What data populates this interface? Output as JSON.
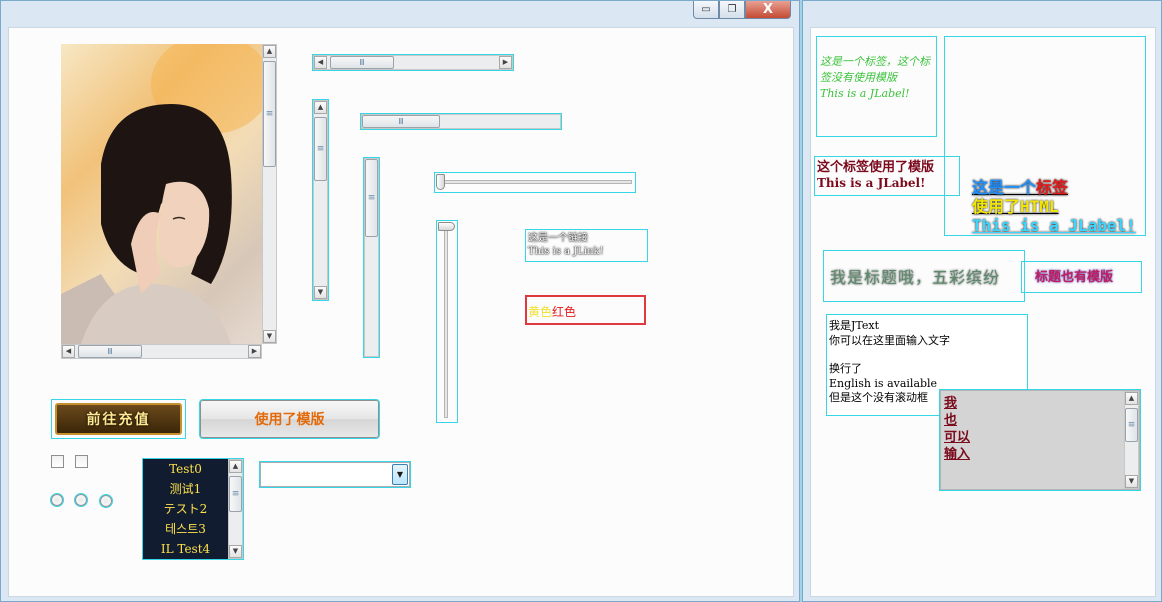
{
  "window_controls": {
    "minimize": "▭",
    "restore": "❐",
    "close": "X"
  },
  "demo_button": {
    "label": "使用了模版"
  },
  "image_button": {
    "label": "前往充值"
  },
  "link_label": {
    "line1": "这是一个链接",
    "line2": "This is a JLink!"
  },
  "color_label": {
    "yellow": "黄色",
    "red": "红色"
  },
  "list": {
    "items": [
      "Test0",
      "测试1",
      "テスト2",
      "테스트3",
      "IL Test4"
    ]
  },
  "combo": {
    "value": ""
  },
  "right": {
    "label1": "这是一个标签，这个标签没有使用模版\nThis is a JLabel!",
    "label2_line1": "这个标签使用了模版",
    "label2_line2": "This is a JLabel!",
    "label3_line1_a": "这是一个",
    "label3_line1_b": "标签",
    "label3_line2_a": "使用了",
    "label3_line2_b": "HTML",
    "label3_line3": "This is a JLabel!",
    "title_label": "我是标题哦，五彩缤纷",
    "title_label2": "标题也有模版",
    "text_area": [
      "我是JText",
      "你可以在这里面输入文字",
      "",
      "换行了",
      "English is available",
      "但是这个没有滚动框"
    ],
    "text_area2": [
      "我",
      "也",
      "可以",
      "输入"
    ]
  },
  "colors": {
    "accent_cyan": "#37d6e6",
    "dark_red": "#7a0a1c",
    "list_bg": "#121c30"
  }
}
